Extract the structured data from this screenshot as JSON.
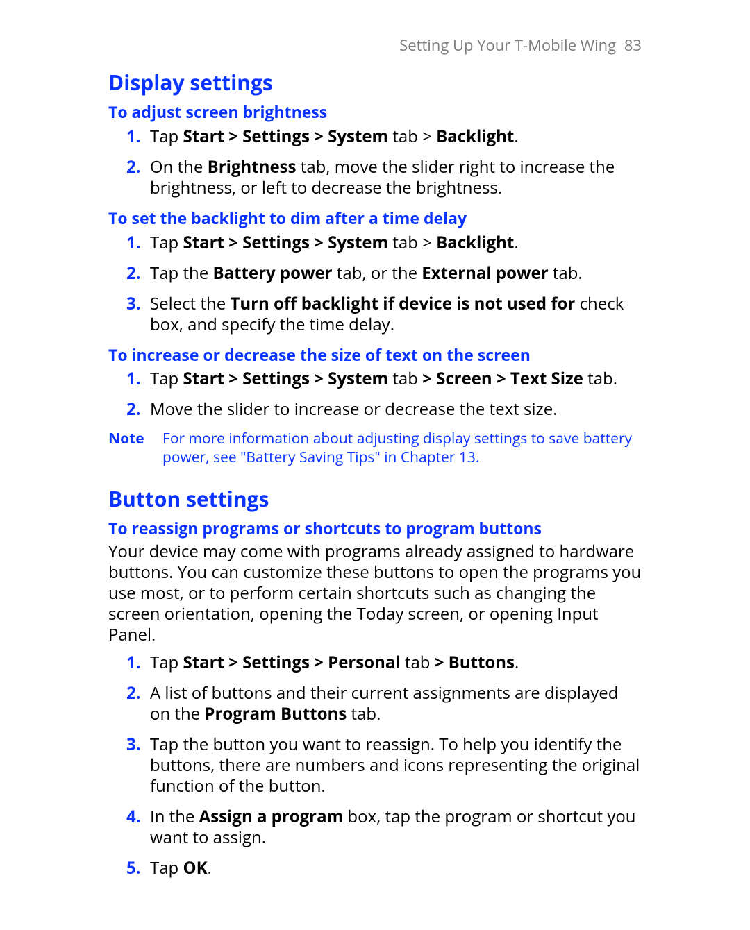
{
  "header": {
    "chapter": "Setting Up Your T-Mobile Wing",
    "page_number": "83"
  },
  "section1": {
    "title": "Display settings",
    "sub1": {
      "heading": "To adjust screen brightness",
      "steps": [
        {
          "num": "1.",
          "pre": "Tap ",
          "bold1": "Start > Settings > System",
          "mid": " tab > ",
          "bold2": "Backlight",
          "tail": "."
        },
        {
          "num": "2.",
          "pre": "On the ",
          "bold1": "Brightness",
          "tail": " tab, move the slider right to increase the brightness, or left to decrease the brightness."
        }
      ]
    },
    "sub2": {
      "heading": "To set the backlight to dim after a time delay",
      "steps": [
        {
          "num": "1.",
          "pre": "Tap ",
          "bold1": "Start > Settings > System",
          "mid": " tab > ",
          "bold2": "Backlight",
          "tail": "."
        },
        {
          "num": "2.",
          "pre": "Tap the ",
          "bold1": "Battery power",
          "mid": " tab, or the ",
          "bold2": "External power",
          "tail": " tab."
        },
        {
          "num": "3.",
          "pre": "Select the ",
          "bold1": "Turn off backlight if device is not used for",
          "tail": " check box, and specify the time delay."
        }
      ]
    },
    "sub3": {
      "heading": "To increase or decrease the size of text on the screen",
      "steps": [
        {
          "num": "1.",
          "pre": "Tap ",
          "bold1": "Start > Settings > System",
          "mid": " tab ",
          "bold2": "> Screen > Text Size",
          "tail": " tab."
        },
        {
          "num": "2.",
          "tail": "Move the slider to increase or decrease the text size."
        }
      ]
    },
    "note": {
      "label": "Note",
      "text": "For more information about adjusting display settings to save battery power, see \"Battery Saving Tips\" in Chapter 13."
    }
  },
  "section2": {
    "title": "Button settings",
    "sub1": {
      "heading": "To reassign programs or shortcuts to program buttons",
      "intro": "Your device may come with programs already assigned to hardware buttons. You can customize these buttons to open the programs you use most, or to perform certain shortcuts such as changing the screen orientation, opening the Today screen, or opening Input Panel.",
      "steps": [
        {
          "num": "1.",
          "pre": "Tap ",
          "bold1": "Start > Settings > Personal",
          "mid": " tab ",
          "bold2": "> Buttons",
          "tail": "."
        },
        {
          "num": "2.",
          "pre": "A list of buttons and their current assignments are displayed on the ",
          "bold1": "Program Buttons",
          "tail": " tab."
        },
        {
          "num": "3.",
          "tail": "Tap the button you want to reassign. To help you identify the buttons, there are numbers and icons representing the original function of the button."
        },
        {
          "num": "4.",
          "pre": "In the ",
          "bold1": "Assign a program",
          "tail": " box, tap the program or shortcut you want to assign."
        },
        {
          "num": "5.",
          "pre": "Tap ",
          "bold1": "OK",
          "tail": "."
        }
      ]
    }
  }
}
